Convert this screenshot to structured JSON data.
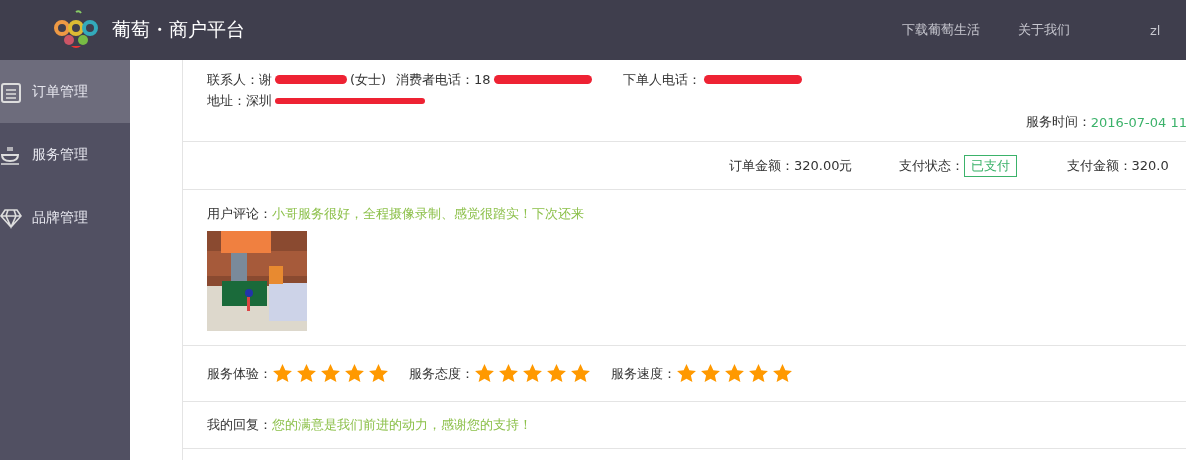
{
  "header": {
    "brand": "葡萄・商户平台",
    "nav": [
      {
        "label": "下载葡萄生活"
      },
      {
        "label": "关于我们"
      }
    ],
    "user": "zl"
  },
  "sidebar": {
    "items": [
      {
        "label": "订单管理",
        "selected": true
      },
      {
        "label": "服务管理",
        "selected": false
      },
      {
        "label": "品牌管理",
        "selected": false
      }
    ]
  },
  "order": {
    "contact": {
      "label": "联系人：",
      "value_start": "谢",
      "value_end": "(女士)"
    },
    "consumer_phone": {
      "label": "消费者电话：",
      "value_start": "18"
    },
    "orderer_phone": {
      "label": "下单人电话："
    },
    "address": {
      "label": "地址：",
      "value_start": "深圳"
    },
    "service_time": {
      "label": "服务时间：",
      "value": "2016-07-04 11"
    },
    "order_amount": {
      "label": "订单金额：",
      "value": "320.00元"
    },
    "pay_status": {
      "label": "支付状态：",
      "value": "已支付"
    },
    "pay_amount": {
      "label": "支付金额：",
      "value": "320.0"
    },
    "comment": {
      "label": "用户评论：",
      "value": "小哥服务很好，全程摄像录制、感觉很踏实！下次还来"
    },
    "ratings": [
      {
        "label": "服务体验：",
        "stars": 5
      },
      {
        "label": "服务态度：",
        "stars": 5
      },
      {
        "label": "服务速度：",
        "stars": 5
      }
    ],
    "reply": {
      "label": "我的回复：",
      "value": "您的满意是我们前进的动力，感谢您的支持！"
    }
  }
}
